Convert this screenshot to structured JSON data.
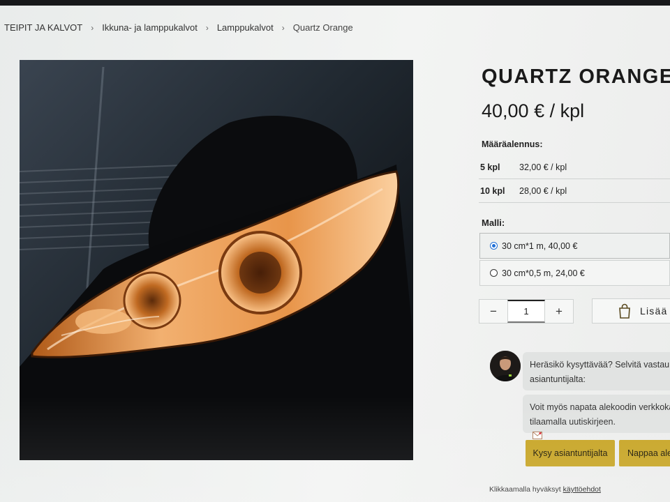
{
  "breadcrumb": {
    "items": [
      "TEIPIT JA KALVOT",
      "Ikkuna- ja lamppukalvot",
      "Lamppukalvot"
    ],
    "current": "Quartz Orange",
    "separator": "›"
  },
  "product": {
    "title": "QUARTZ ORANGE",
    "price": "40,00 € / kpl",
    "image_icon": "headlight-photo"
  },
  "discounts": {
    "heading": "Määräalennus:",
    "rows": [
      {
        "qty": "5 kpl",
        "price": "32,00 € / kpl"
      },
      {
        "qty": "10 kpl",
        "price": "28,00 € / kpl"
      }
    ]
  },
  "variants": {
    "heading": "Malli:",
    "options": [
      {
        "label": "30 cm*1 m, 40,00 €",
        "selected": true
      },
      {
        "label": "30 cm*0,5 m, 24,00 €",
        "selected": false
      }
    ]
  },
  "quantity": {
    "minus": "−",
    "value": "1",
    "plus": "+"
  },
  "cart": {
    "label": "Lisää",
    "icon": "shopping-bag-icon"
  },
  "chat": {
    "line1": "Heräsikö kysyttävää? Selvitä vastau",
    "line2": "asiantuntijalta:",
    "line3": "Voit myös napata alekoodin verkkoka",
    "line4": "tilaamalla uutiskirjeen.",
    "ask_button": "Kysy asiantuntijalta",
    "grab_button": "Nappaa ale"
  },
  "terms": {
    "prefix": "Klikkaamalla hyväksyt",
    "link": "käyttöehdot"
  },
  "colors": {
    "accent": "#c8a628",
    "radio": "#1f6fd6",
    "lamp": "#e8a050"
  }
}
